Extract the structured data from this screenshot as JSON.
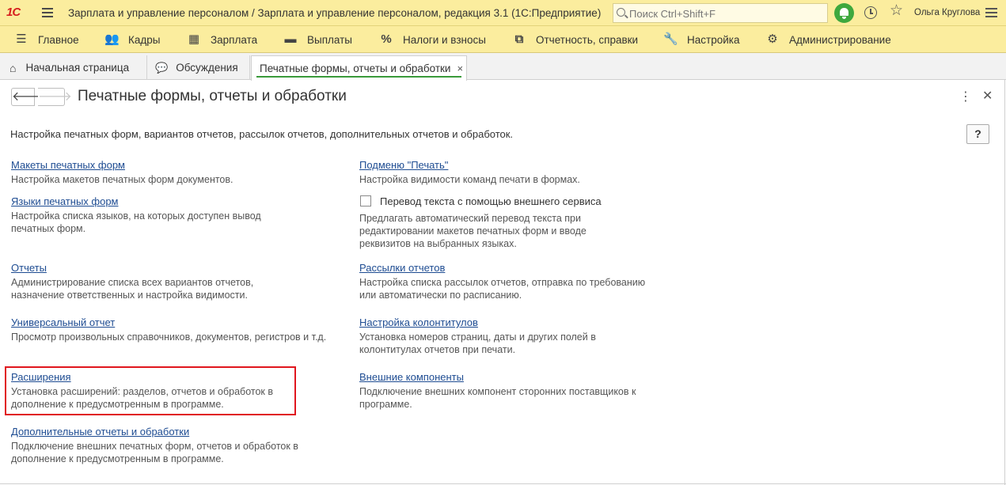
{
  "titlebar": {
    "logo": "1С",
    "title": "Зарплата и управление персоналом / Зарплата и управление персоналом, редакция 3.1  (1С:Предприятие)",
    "search_placeholder": "Поиск Ctrl+Shift+F",
    "user": "Ольга Круглова"
  },
  "sections": [
    {
      "label": "Главное",
      "icon": "menu-icon"
    },
    {
      "label": "Кадры",
      "icon": "people-icon"
    },
    {
      "label": "Зарплата",
      "icon": "calculator-icon"
    },
    {
      "label": "Выплаты",
      "icon": "wallet-icon"
    },
    {
      "label": "Налоги и взносы",
      "icon": "percent-icon"
    },
    {
      "label": "Отчетность, справки",
      "icon": "documents-icon"
    },
    {
      "label": "Настройка",
      "icon": "wrench-icon"
    },
    {
      "label": "Администрирование",
      "icon": "gear-icon"
    }
  ],
  "tabs": [
    {
      "label": "Начальная страница",
      "icon": "home-icon"
    },
    {
      "label": "Обсуждения",
      "icon": "chat-icon"
    },
    {
      "label": "Печатные формы, отчеты и обработки",
      "close": "×"
    }
  ],
  "form": {
    "title": "Печатные формы, отчеты и обработки",
    "description": "Настройка печатных форм, вариантов отчетов, рассылок отчетов, дополнительных отчетов и обработок.",
    "help": "?",
    "back": "🡐",
    "forward": "🡒",
    "more": "⋮",
    "close": "✕"
  },
  "left": [
    {
      "link": "Макеты печатных форм",
      "text": [
        "Настройка макетов печатных форм документов."
      ]
    },
    {
      "link": "Языки печатных форм",
      "text": [
        "Настройка списка языков, на которых доступен вывод",
        "печатных форм."
      ]
    },
    {
      "link": "Отчеты",
      "text": [
        "Администрирование списка всех вариантов отчетов,",
        "назначение ответственных и настройка видимости."
      ]
    },
    {
      "link": "Универсальный отчет",
      "text": [
        "Просмотр произвольных справочников, документов, регистров и т.д."
      ]
    },
    {
      "link": "Расширения",
      "text": [
        "Установка расширений: разделов, отчетов и обработок в",
        "дополнение к предусмотренным в программе."
      ]
    },
    {
      "link": "Дополнительные отчеты и обработки",
      "text": [
        "Подключение внешних печатных форм, отчетов и обработок в",
        "дополнение к предусмотренным в программе."
      ]
    }
  ],
  "right": [
    {
      "link": "Подменю \"Печать\"",
      "text": [
        "Настройка видимости команд печати в формах."
      ]
    },
    {
      "checkbox": "Перевод текста с помощью внешнего сервиса",
      "checked": false,
      "text": [
        "Предлагать автоматический перевод текста при",
        "редактировании макетов печатных форм и вводе",
        "реквизитов на выбранных языках."
      ]
    },
    {
      "link": "Рассылки отчетов",
      "text": [
        "Настройка списка рассылок отчетов, отправка по требованию",
        "или автоматически по расписанию."
      ]
    },
    {
      "link": "Настройка колонтитулов",
      "text": [
        "Установка номеров страниц, даты и других полей в",
        "колонтитулах отчетов при печати."
      ]
    },
    {
      "link": "Внешние компоненты",
      "text": [
        "Подключение внешних компонент сторонних поставщиков к",
        "программе."
      ]
    }
  ],
  "colors": {
    "accent_yellow": "#fbed9e",
    "link": "#1e4c92",
    "highlight": "#e0161e",
    "green": "#3ea83e"
  }
}
